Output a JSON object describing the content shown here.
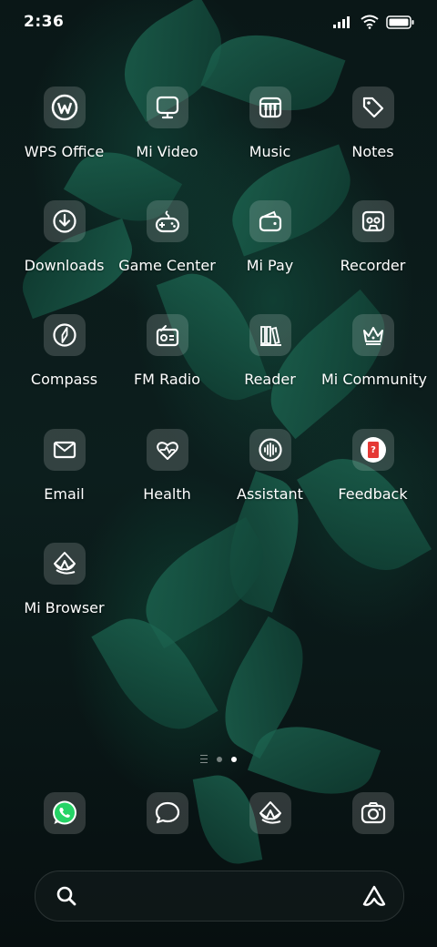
{
  "status": {
    "time": "2:36"
  },
  "apps": [
    {
      "label": "WPS Office",
      "icon": "wps-office-icon"
    },
    {
      "label": "Mi Video",
      "icon": "monitor-icon"
    },
    {
      "label": "Music",
      "icon": "piano-icon"
    },
    {
      "label": "Notes",
      "icon": "tag-icon"
    },
    {
      "label": "Downloads",
      "icon": "download-icon"
    },
    {
      "label": "Game Center",
      "icon": "gamepad-icon"
    },
    {
      "label": "Mi Pay",
      "icon": "wallet-icon"
    },
    {
      "label": "Recorder",
      "icon": "cassette-icon"
    },
    {
      "label": "Compass",
      "icon": "compass-icon"
    },
    {
      "label": "FM Radio",
      "icon": "radio-icon"
    },
    {
      "label": "Reader",
      "icon": "books-icon"
    },
    {
      "label": "Mi Community",
      "icon": "crown-icon"
    },
    {
      "label": "Email",
      "icon": "envelope-icon"
    },
    {
      "label": "Health",
      "icon": "heart-pulse-icon"
    },
    {
      "label": "Assistant",
      "icon": "voice-wave-icon"
    },
    {
      "label": "Feedback",
      "icon": "feedback-icon"
    },
    {
      "label": "Mi Browser",
      "icon": "browser-icon"
    }
  ],
  "dock": [
    {
      "icon": "whatsapp-icon"
    },
    {
      "icon": "chat-bubble-icon"
    },
    {
      "icon": "browser-icon"
    },
    {
      "icon": "camera-icon"
    }
  ],
  "pages": {
    "count": 2,
    "current": 2
  },
  "colors": {
    "whatsapp": "#25d366",
    "feedback": "#e53935",
    "icon_bg": "rgba(255,255,255,0.16)"
  }
}
